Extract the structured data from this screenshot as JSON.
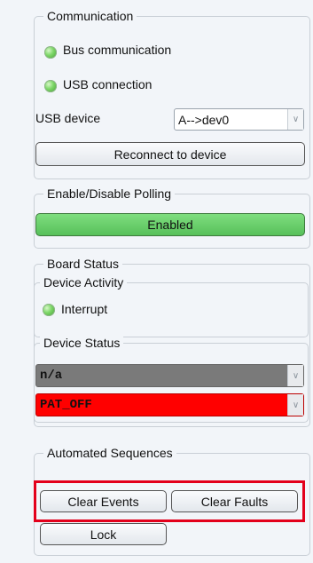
{
  "communication": {
    "title": "Communication",
    "bus_label": "Bus communication",
    "usb_label": "USB connection",
    "usb_device_label": "USB device",
    "usb_device_value": "A-->dev0",
    "reconnect_label": "Reconnect to device"
  },
  "polling": {
    "title": "Enable/Disable Polling",
    "button_label": "Enabled",
    "button_color": "#66cc66"
  },
  "board_status": {
    "title": "Board Status",
    "device_activity": {
      "title": "Device Activity",
      "interrupt_label": "Interrupt"
    },
    "device_status": {
      "title": "Device Status",
      "field1_value": "n/a",
      "field1_color": "#7a7a7a",
      "field2_value": "PAT_OFF",
      "field2_color": "#ff0000"
    }
  },
  "sequences": {
    "title": "Automated Sequences",
    "clear_events_label": "Clear Events",
    "clear_faults_label": "Clear Faults",
    "lock_label": "Lock",
    "highlight_color": "#e3001b"
  }
}
